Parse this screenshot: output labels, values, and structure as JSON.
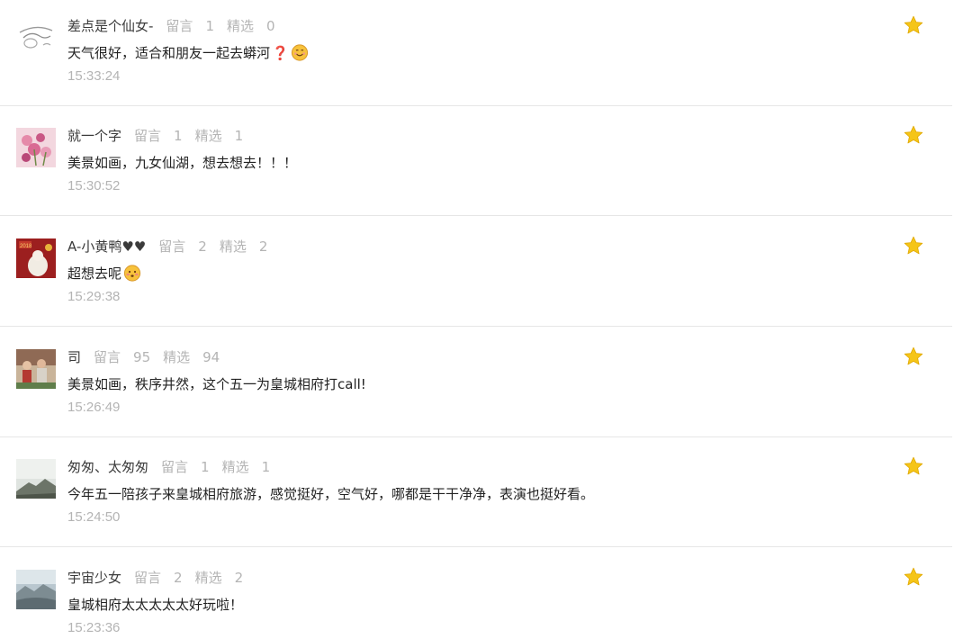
{
  "labels": {
    "comments": "留言",
    "featured": "精选"
  },
  "colors": {
    "star": "#f5c518",
    "nickname": "#3b3b3b",
    "meta": "#b4b4b4",
    "text": "#222222",
    "divider": "#e6e6e6"
  },
  "comments": [
    {
      "nickname": "差点是个仙女-",
      "comment_count": "1",
      "featured_count": "0",
      "text": "天气很好，适合和朋友一起去蟒河",
      "emoji": [
        "question-mark-icon",
        "smiling-face-icon"
      ],
      "time": "15:33:24",
      "avatar": "sketch-avatar"
    },
    {
      "nickname": "就一个字",
      "comment_count": "1",
      "featured_count": "1",
      "text": "美景如画，九女仙湖，想去想去！！！",
      "emoji": [],
      "time": "15:30:52",
      "avatar": "pink-flower-avatar"
    },
    {
      "nickname": "A-小黄鸭",
      "nickname_suffix": "♥♥",
      "comment_count": "2",
      "featured_count": "2",
      "text": "超想去呢",
      "emoji": [
        "blushing-face-icon"
      ],
      "time": "15:29:38",
      "avatar": "red-card-avatar"
    },
    {
      "nickname": "司",
      "comment_count": "95",
      "featured_count": "94",
      "text": "美景如画，秩序井然，这个五一为皇城相府打call!",
      "emoji": [],
      "time": "15:26:49",
      "avatar": "people-photo-avatar"
    },
    {
      "nickname": "匆匆、太匆匆",
      "comment_count": "1",
      "featured_count": "1",
      "text": "今年五一陪孩子来皇城相府旅游，感觉挺好，空气好，哪都是干干净净，表演也挺好看。",
      "emoji": [],
      "time": "15:24:50",
      "avatar": "mountain-avatar"
    },
    {
      "nickname": "宇宙少女",
      "comment_count": "2",
      "featured_count": "2",
      "text": "皇城相府太太太太太好玩啦！",
      "emoji": [],
      "time": "15:23:36",
      "avatar": "seaside-rock-avatar"
    }
  ]
}
